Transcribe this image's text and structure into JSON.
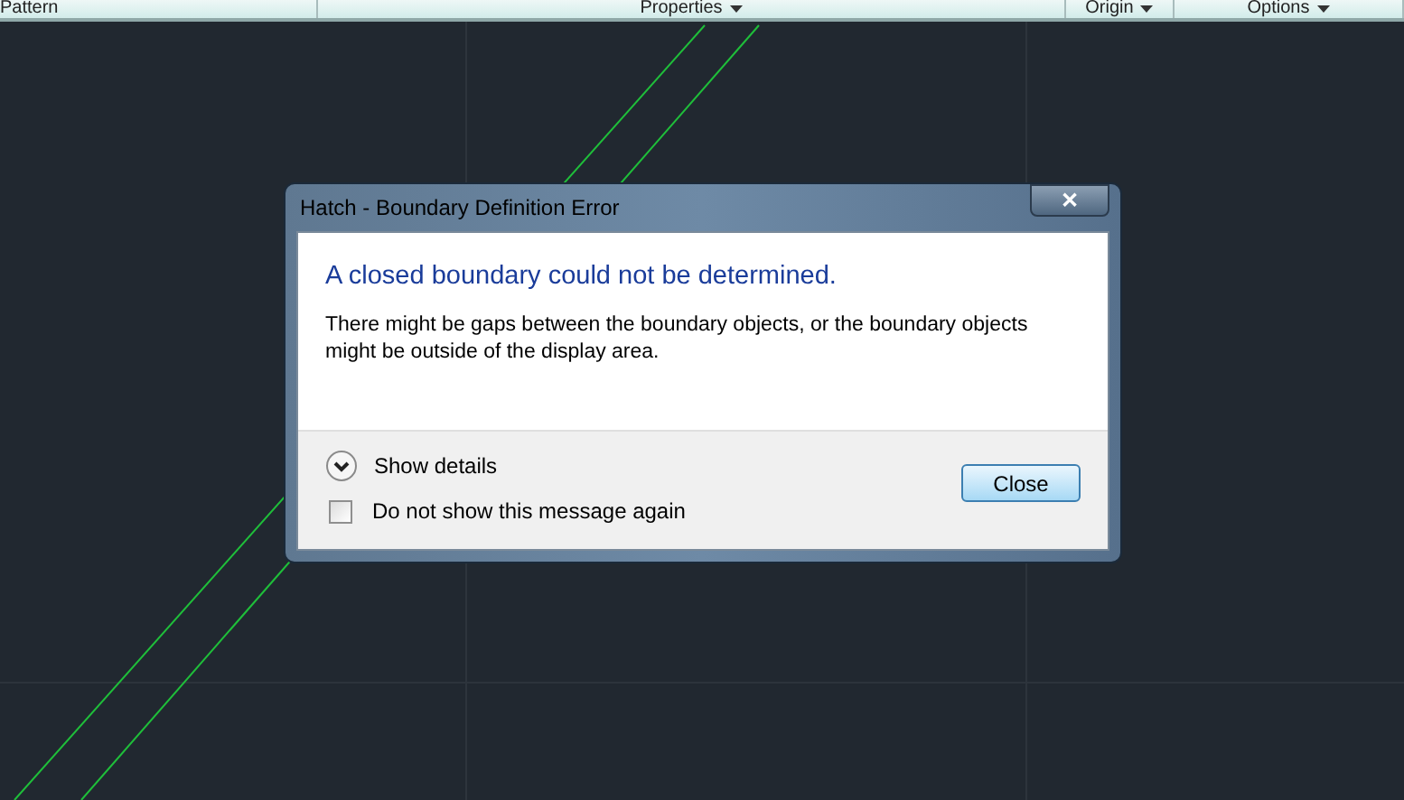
{
  "ribbon": {
    "panels": [
      {
        "label": "Pattern",
        "dropdown": false
      },
      {
        "label": "Properties",
        "dropdown": true
      },
      {
        "label": "Origin",
        "dropdown": true
      },
      {
        "label": "Options",
        "dropdown": true
      }
    ]
  },
  "dialog": {
    "title": "Hatch - Boundary Definition Error",
    "close_glyph": "✕",
    "heading": "A closed boundary could not be determined.",
    "message": "There might be gaps between the boundary objects, or the boundary objects might be outside of the display area.",
    "details_label": "Show details",
    "checkbox": {
      "label": "Do not show this message again",
      "checked": false
    },
    "button": "Close"
  }
}
